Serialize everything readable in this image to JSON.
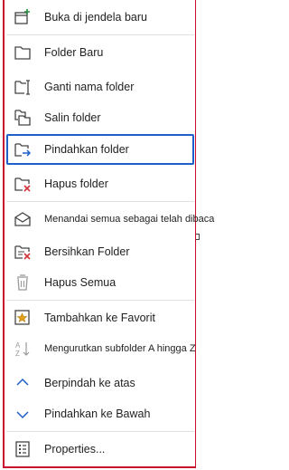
{
  "menu": {
    "items": [
      {
        "label": "Buka di jendela baru",
        "icon": "new-window-icon"
      },
      {
        "label": "Folder Baru",
        "icon": "new-folder-icon"
      },
      {
        "label": "Ganti nama folder",
        "icon": "rename-folder-icon"
      },
      {
        "label": "Salin folder",
        "icon": "copy-folder-icon"
      },
      {
        "label": "Pindahkan folder",
        "icon": "move-folder-icon",
        "selected": true
      },
      {
        "label": "Hapus folder",
        "icon": "delete-folder-icon"
      },
      {
        "label": "Menandai semua sebagai telah dibaca",
        "icon": "mark-read-icon"
      },
      {
        "label": "Bersihkan Folder",
        "icon": "clean-folder-icon"
      },
      {
        "label": "Hapus Semua",
        "icon": "delete-all-icon"
      },
      {
        "label": "Tambahkan ke Favorit",
        "icon": "favorite-icon"
      },
      {
        "label": "Mengurutkan subfolder A hingga Z",
        "icon": "sort-az-icon"
      },
      {
        "label": "Berpindah ke atas",
        "icon": "move-up-icon"
      },
      {
        "label": "Pindahkan ke Bawah",
        "icon": "move-down-icon"
      },
      {
        "label": "Properties...",
        "icon": "properties-icon"
      }
    ]
  },
  "colors": {
    "accent": "#1f5fc9",
    "border": "#c8102e",
    "delete": "#d13438",
    "icon": "#444444"
  }
}
